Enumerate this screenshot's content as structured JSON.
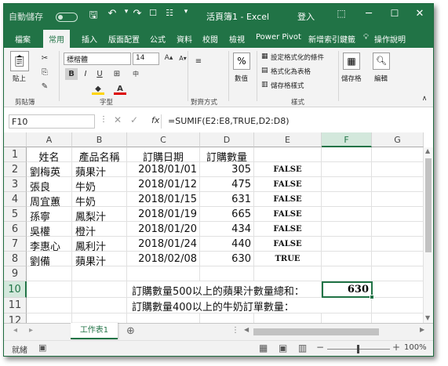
{
  "titlebar": {
    "autosave_label": "自動儲存",
    "toggle_state": "關閉",
    "doc_title": "活頁簿1 - Excel",
    "signin": "登入"
  },
  "tabs": [
    "檔案",
    "常用",
    "插入",
    "版面配置",
    "公式",
    "資料",
    "校閱",
    "檢視",
    "Power Pivot",
    "新增索引鍵籤",
    "操作說明"
  ],
  "ribbon": {
    "clipboard_group": "剪貼簿",
    "paste_label": "貼上",
    "font_name": "標楷體",
    "font_size": "14",
    "font_group": "字型",
    "align_group": "對齊方式",
    "number_label": "數值",
    "conditional_format": "設定格式化的條件",
    "format_as_table": "格式化為表格",
    "cell_styles": "儲存格樣式",
    "styles_group": "樣式",
    "cells_label": "儲存格",
    "editing_label": "編輯"
  },
  "formula_bar": {
    "name_box": "F10",
    "fx": "fx",
    "formula": "=SUMIF(E2:E8,TRUE,D2:D8)"
  },
  "columns": [
    "A",
    "B",
    "C",
    "D",
    "E",
    "F",
    "G"
  ],
  "rows": [
    "1",
    "2",
    "3",
    "4",
    "5",
    "6",
    "7",
    "8",
    "9",
    "10",
    "11",
    "12"
  ],
  "table": {
    "headers": [
      "姓名",
      "產品名稱",
      "訂購日期",
      "訂購數量"
    ],
    "records": [
      [
        "劉梅英",
        "蘋果汁",
        "2018/01/01",
        "305",
        "FALSE"
      ],
      [
        "張良",
        "牛奶",
        "2018/01/12",
        "475",
        "FALSE"
      ],
      [
        "周宜蕙",
        "牛奶",
        "2018/01/15",
        "631",
        "FALSE"
      ],
      [
        "孫寧",
        "鳳梨汁",
        "2018/01/19",
        "665",
        "FALSE"
      ],
      [
        "吳權",
        "橙汁",
        "2018/01/20",
        "434",
        "FALSE"
      ],
      [
        "李惠心",
        "鳳利汁",
        "2018/01/24",
        "440",
        "FALSE"
      ],
      [
        "劉備",
        "蘋果汁",
        "2018/02/08",
        "630",
        "TRUE"
      ]
    ]
  },
  "notes": {
    "row10_label": "訂購數量500以上的蘋果汁數量總和：",
    "row10_value": "630",
    "row11_label": "訂購數量400以上的牛奶訂單數量："
  },
  "sheet_tab": "工作表1",
  "status": {
    "ready": "就緒",
    "zoom": "100%"
  },
  "colors": {
    "accent": "#217346",
    "ribbon_bg": "#f3f3f3"
  },
  "icons": [
    "save-icon",
    "undo-icon",
    "redo-icon",
    "customize-icon",
    "ribbon-options-icon",
    "minimize-icon",
    "maximize-icon",
    "close-icon",
    "lightbulb-icon",
    "paste-icon",
    "cut-icon",
    "copy-icon",
    "format-painter-icon",
    "bold-icon",
    "italic-icon",
    "underline-icon",
    "border-icon",
    "fill-color-icon",
    "font-color-icon",
    "percent-icon",
    "cells-icon",
    "search-icon",
    "add-sheet-icon",
    "normal-view-icon",
    "page-layout-icon",
    "page-break-icon"
  ]
}
